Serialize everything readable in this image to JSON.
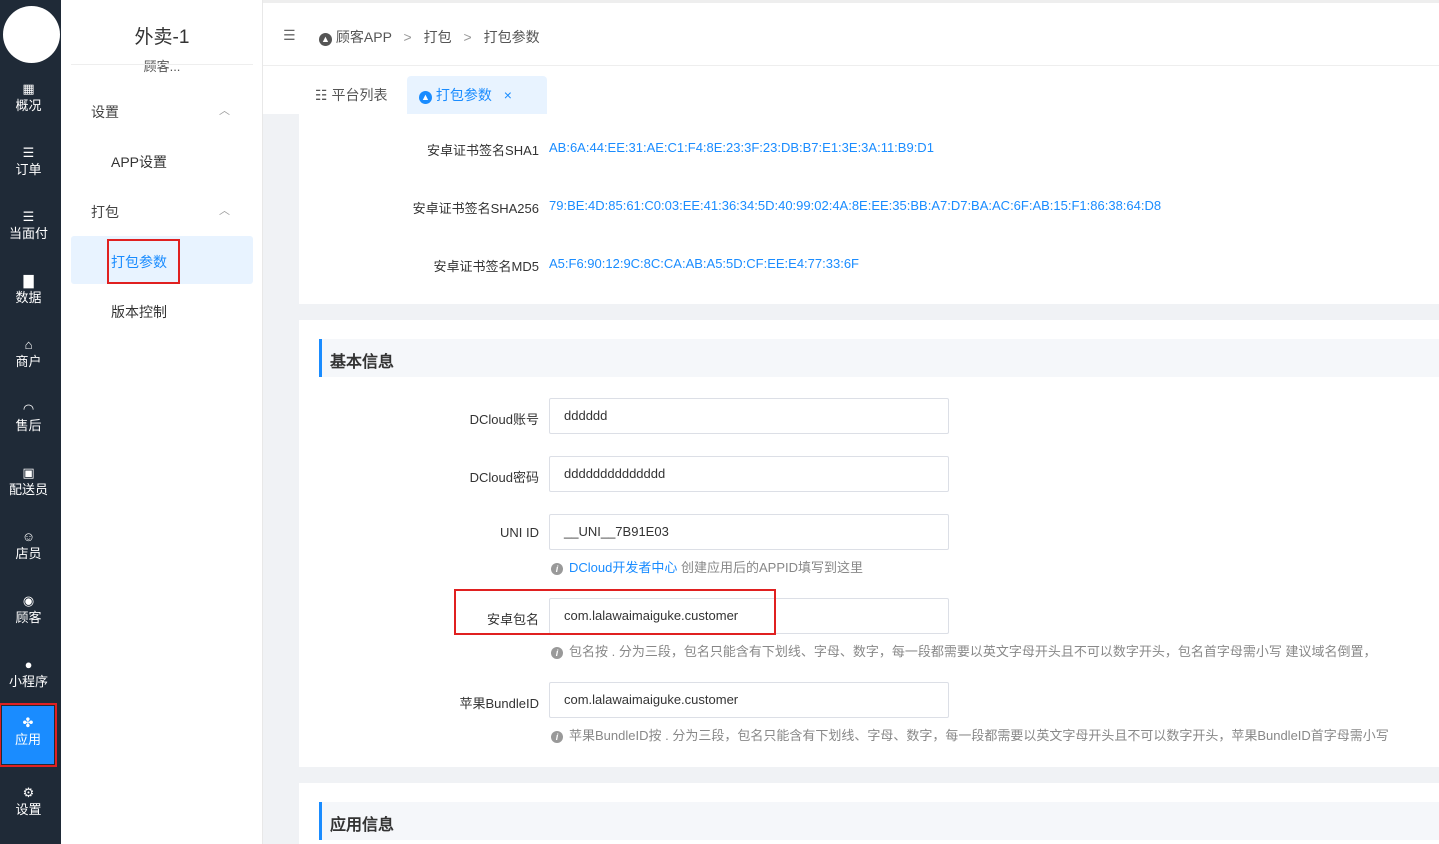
{
  "rail": {
    "items": [
      {
        "icon": "grid-icon",
        "glyph": "▦",
        "label": "概况"
      },
      {
        "icon": "list-icon",
        "glyph": "☰",
        "label": "订单"
      },
      {
        "icon": "list-icon",
        "glyph": "☰",
        "label": "当面付"
      },
      {
        "icon": "bar-chart-icon",
        "glyph": "▇",
        "label": "数据"
      },
      {
        "icon": "store-icon",
        "glyph": "⌂",
        "label": "商户"
      },
      {
        "icon": "headset-icon",
        "glyph": "◠",
        "label": "售后"
      },
      {
        "icon": "delivery-icon",
        "glyph": "▣",
        "label": "配送员"
      },
      {
        "icon": "staff-icon",
        "glyph": "☺",
        "label": "店员"
      },
      {
        "icon": "customer-icon",
        "glyph": "◉",
        "label": "顾客"
      },
      {
        "icon": "wechat-icon",
        "glyph": "●",
        "label": "小程序"
      },
      {
        "icon": "apps-icon",
        "glyph": "✤",
        "label": "应用"
      },
      {
        "icon": "settings-icon",
        "glyph": "⚙",
        "label": "设置"
      }
    ]
  },
  "side": {
    "title": "外卖-1",
    "subtitle": "顾客...",
    "group1": "设置",
    "group1_item": "APP设置",
    "group2": "打包",
    "group2_active": "打包参数",
    "group2_item": "版本控制"
  },
  "breadcrumb": {
    "b1": "顾客APP",
    "sep": ">",
    "b2": "打包",
    "b3": "打包参数"
  },
  "tabs": {
    "t1": "平台列表",
    "t2": "打包参数",
    "close": "×"
  },
  "cert": {
    "sha1_label": "安卓证书签名SHA1",
    "sha1": "AB:6A:44:EE:31:AE:C1:F4:8E:23:3F:23:DB:B7:E1:3E:3A:11:B9:D1",
    "sha256_label": "安卓证书签名SHA256",
    "sha256": "79:BE:4D:85:61:C0:03:EE:41:36:34:5D:40:99:02:4A:8E:EE:35:BB:A7:D7:BA:AC:6F:AB:15:F1:86:38:64:D8",
    "md5_label": "安卓证书签名MD5",
    "md5": "A5:F6:90:12:9C:8C:CA:AB:A5:5D:CF:EE:E4:77:33:6F"
  },
  "basic": {
    "title": "基本信息",
    "dcloud_account_label": "DCloud账号",
    "dcloud_account": "dddddd",
    "dcloud_pwd_label": "DCloud密码",
    "dcloud_pwd": "dddddddddddddd",
    "uniid_label": "UNI ID",
    "uniid": "__UNI__7B91E03",
    "uniid_hint_link": "DCloud开发者中心",
    "uniid_hint": " 创建应用后的APPID填写到这里",
    "pkg_label": "安卓包名",
    "pkg": "com.lalawaimaiguke.customer",
    "pkg_hint": "包名按 . 分为三段，包名只能含有下划线、字母、数字，每一段都需要以英文字母开头且不可以数字开头，包名首字母需小写 建议域名倒置，",
    "bundle_label": "苹果BundleID",
    "bundle": "com.lalawaimaiguke.customer",
    "bundle_hint": "苹果BundleID按 . 分为三段，包名只能含有下划线、字母、数字，每一段都需要以英文字母开头且不可以数字开头，苹果BundleID首字母需小写"
  },
  "app": {
    "title": "应用信息"
  }
}
